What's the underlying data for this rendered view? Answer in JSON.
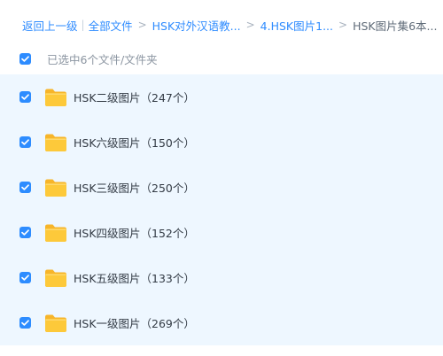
{
  "breadcrumb": {
    "back": "返回上一级",
    "all_files": "全部文件",
    "path": [
      "HSK对外汉语教...",
      "4.HSK图片1..."
    ],
    "current": "HSK图片集6本..."
  },
  "selection": {
    "summary": "已选中6个文件/文件夹",
    "all_checked": true
  },
  "files": [
    {
      "name": "HSK二级图片（247个）",
      "checked": true,
      "icon": "folder-icon"
    },
    {
      "name": "HSK六级图片（150个）",
      "checked": true,
      "icon": "folder-icon"
    },
    {
      "name": "HSK三级图片（250个）",
      "checked": true,
      "icon": "folder-icon"
    },
    {
      "name": "HSK四级图片（152个）",
      "checked": true,
      "icon": "folder-icon"
    },
    {
      "name": "HSK五级图片（133个）",
      "checked": true,
      "icon": "folder-icon"
    },
    {
      "name": "HSK一级图片（269个）",
      "checked": true,
      "icon": "folder-icon"
    }
  ],
  "colors": {
    "accent": "#2d8cff",
    "selected_row_bg": "#eef7ff",
    "folder": "#fdc93a"
  }
}
